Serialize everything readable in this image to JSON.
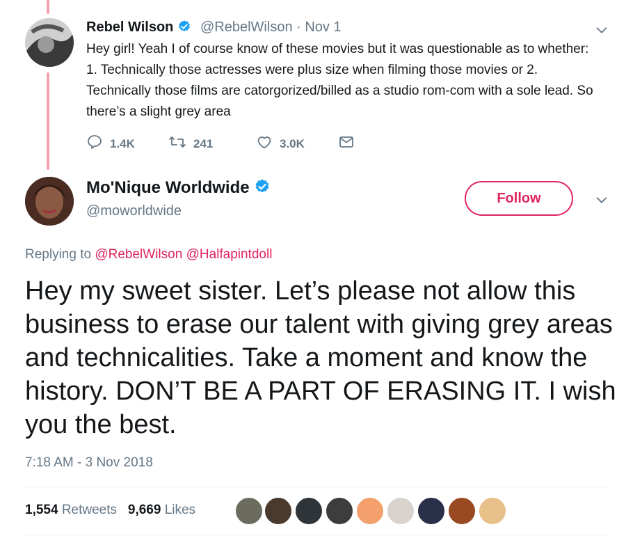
{
  "reply_tweet": {
    "author_name": "Rebel Wilson",
    "author_handle": "@RebelWilson",
    "date_separator": " · ",
    "date": "Nov 1",
    "text": "Hey girl! Yeah I of course know of these movies but it was questionable as to whether: 1. Technically those actresses were plus size when filming those movies or 2. Technically those films are catorgorized/billed as a studio rom-com with a sole lead. So there’s a slight grey area",
    "replies": "1.4K",
    "retweets": "241",
    "likes": "3.0K"
  },
  "main_tweet": {
    "author_name": "Mo'Nique Worldwide",
    "author_handle": "@moworldwide",
    "follow_label": "Follow",
    "replying_prefix": "Replying to ",
    "replying_mentions": "@RebelWilson @Halfapintdoll",
    "text": "Hey my sweet sister. Let’s please not allow this business to erase our talent with giving grey areas and technicalities. Take a moment and know the history. DON’T BE A PART OF ERASING IT. I wish you the best.",
    "timestamp": "7:18 AM - 3 Nov 2018",
    "retweet_count": "1,554",
    "retweet_label": "Retweets",
    "like_count": "9,669",
    "like_label": "Likes"
  },
  "colors": {
    "accent": "#e0245e",
    "verified": "#1da1f2",
    "secondary_text": "#657786",
    "thread_line": "#f5a0ae"
  },
  "icons": [
    "reply-icon",
    "retweet-icon",
    "heart-icon",
    "direct-message-icon",
    "verified-badge-icon",
    "chevron-down-icon"
  ]
}
